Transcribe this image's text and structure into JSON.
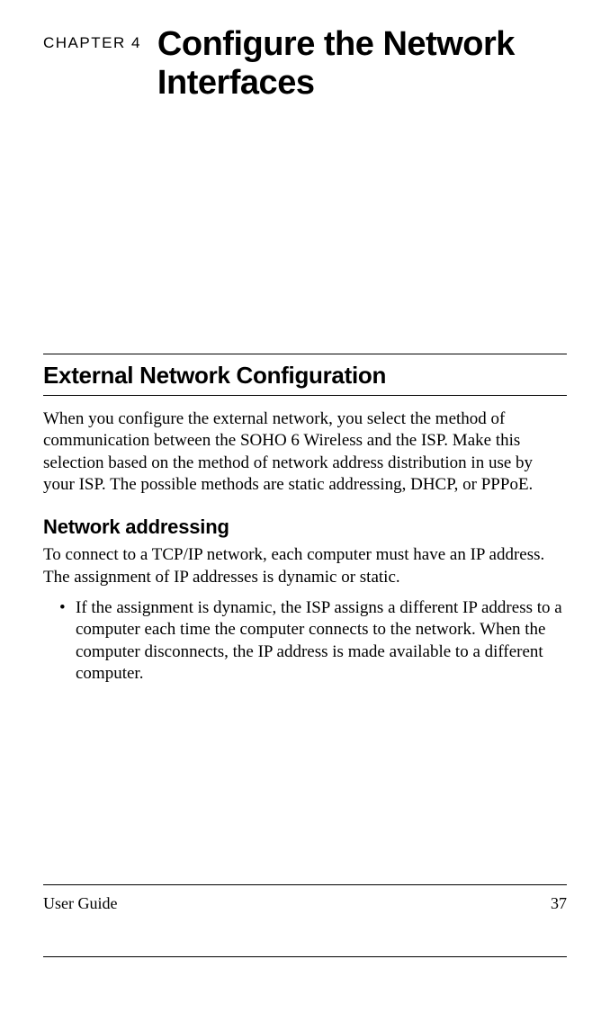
{
  "chapter": {
    "label": "CHAPTER 4",
    "title": "Configure the Network Interfaces"
  },
  "section": {
    "heading": "External Network Configuration",
    "body": "When you configure the external network, you select the method of communication between the SOHO 6 Wireless and the ISP. Make this selection based on the method of network address distribution in use by your ISP. The possible methods are static addressing, DHCP, or PPPoE."
  },
  "subsection": {
    "heading": "Network addressing",
    "intro": "To connect to a TCP/IP network, each computer must have an IP address. The assignment of IP addresses is dynamic or static.",
    "bullets": [
      "If the assignment is dynamic, the ISP assigns a different IP address to a computer each time the computer connects to the network. When the computer disconnects, the IP address is made available to a different computer."
    ]
  },
  "footer": {
    "left": "User Guide",
    "right": "37"
  }
}
